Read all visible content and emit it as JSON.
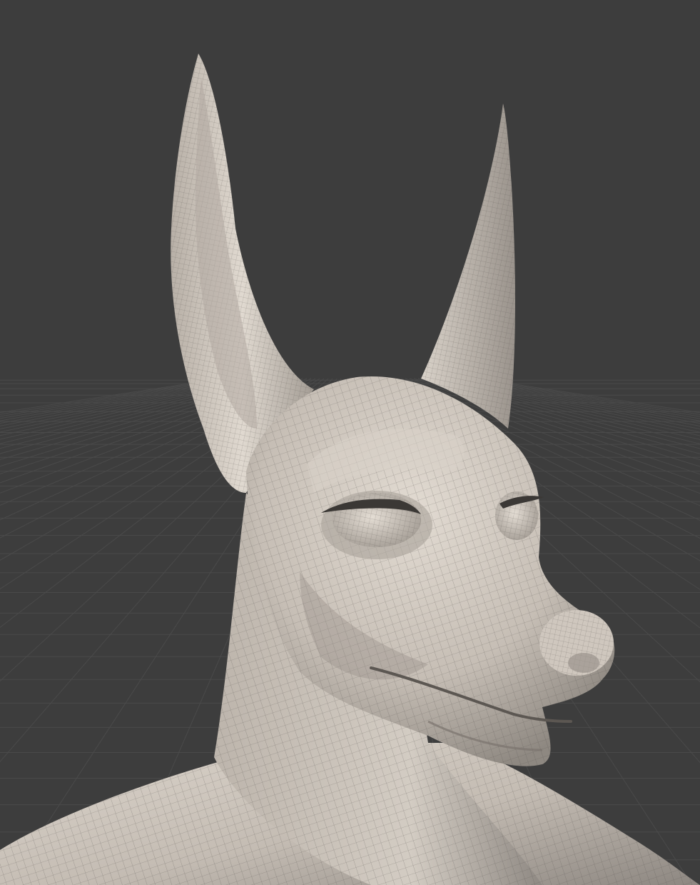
{
  "viewport": {
    "background_color": "#3d3d3d",
    "grid_color": "#4a4a4a",
    "grid_visible": true
  },
  "model": {
    "base_color": "#c9c1b8",
    "shadow_color": "#6f6a65",
    "highlight_color": "#e6dfd7",
    "wire_color": "#4f4a46",
    "wireframe_visible": true,
    "shading": "matcap-clay"
  }
}
